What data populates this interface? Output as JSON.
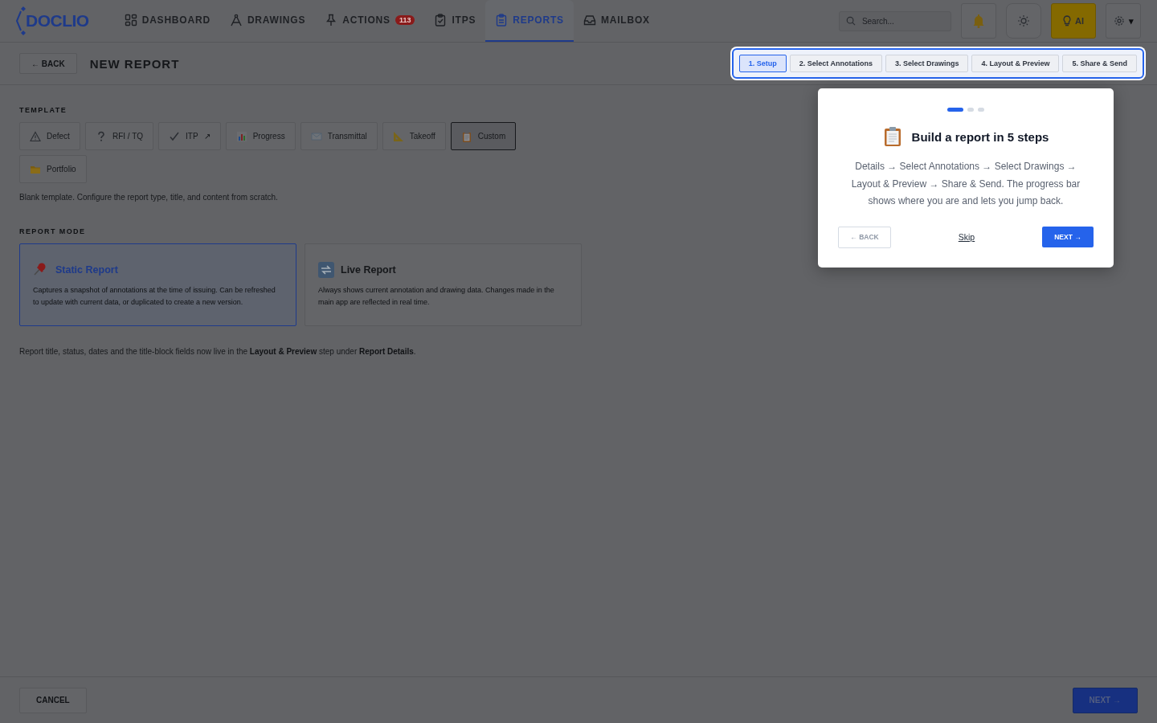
{
  "header": {
    "logo": "DOCLIO",
    "nav": [
      {
        "kind": "dashboard",
        "label": "DASHBOARD",
        "selected": false
      },
      {
        "kind": "drawings",
        "label": "DRAWINGS",
        "selected": false
      },
      {
        "kind": "actions",
        "label": "ACTIONS",
        "badge": "113",
        "selected": false
      },
      {
        "kind": "itps",
        "label": "ITPS",
        "selected": false
      },
      {
        "kind": "reports",
        "label": "REPORTS",
        "selected": true
      },
      {
        "kind": "mailbox",
        "label": "MAILBOX",
        "selected": false
      }
    ],
    "search": {
      "placeholder": "Search..."
    },
    "ai_button": "AI",
    "settings_caret": "▾"
  },
  "subheader": {
    "back": "← BACK",
    "title": "NEW REPORT",
    "steps": [
      {
        "label": "1. Setup",
        "selected": true
      },
      {
        "label": "2. Select Annotations",
        "selected": false
      },
      {
        "label": "3. Select Drawings",
        "selected": false
      },
      {
        "label": "4. Layout & Preview",
        "selected": false
      },
      {
        "label": "5. Share & Send",
        "selected": false
      }
    ]
  },
  "template": {
    "heading": "TEMPLATE",
    "options": [
      {
        "kind": "defect",
        "label": "Defect",
        "selected": false
      },
      {
        "kind": "rfi",
        "label": "RFI / TQ",
        "selected": false
      },
      {
        "kind": "itp",
        "label": "ITP",
        "suffix": "↗",
        "selected": false
      },
      {
        "kind": "progress",
        "label": "Progress",
        "selected": false
      },
      {
        "kind": "transmittal",
        "label": "Transmittal",
        "selected": false
      },
      {
        "kind": "takeoff",
        "label": "Takeoff",
        "selected": false
      },
      {
        "kind": "custom",
        "label": "Custom",
        "selected": true
      },
      {
        "kind": "portfolio",
        "label": "Portfolio",
        "selected": false
      }
    ],
    "description": "Blank template. Configure the report type, title, and content from scratch."
  },
  "report_mode": {
    "heading": "REPORT MODE",
    "options": [
      {
        "kind": "static",
        "title": "Static Report",
        "description": "Captures a snapshot of annotations at the time of issuing. Can be refreshed to update with current data, or duplicated to create a new version.",
        "selected": true
      },
      {
        "kind": "live",
        "title": "Live Report",
        "description": "Always shows current annotation and drawing data. Changes made in the main app are reflected in real time.",
        "selected": false
      }
    ]
  },
  "note": "Report title, status, dates and the title-block fields now live in the **Layout & Preview** step under **Report Details**.",
  "tour": {
    "dots": [
      {
        "selected": true
      },
      {
        "selected": false
      },
      {
        "selected": false
      }
    ],
    "title": "Build a report in 5 steps",
    "body": "Details → Select Annotations → Select Drawings → Layout & Preview → Share & Send. The progress bar shows where you are and lets you jump back.",
    "back": {
      "label": "← BACK",
      "disabled": true
    },
    "skip": "Skip",
    "next": "NEXT →"
  },
  "footer": {
    "cancel": "CANCEL",
    "next": "NEXT →"
  }
}
